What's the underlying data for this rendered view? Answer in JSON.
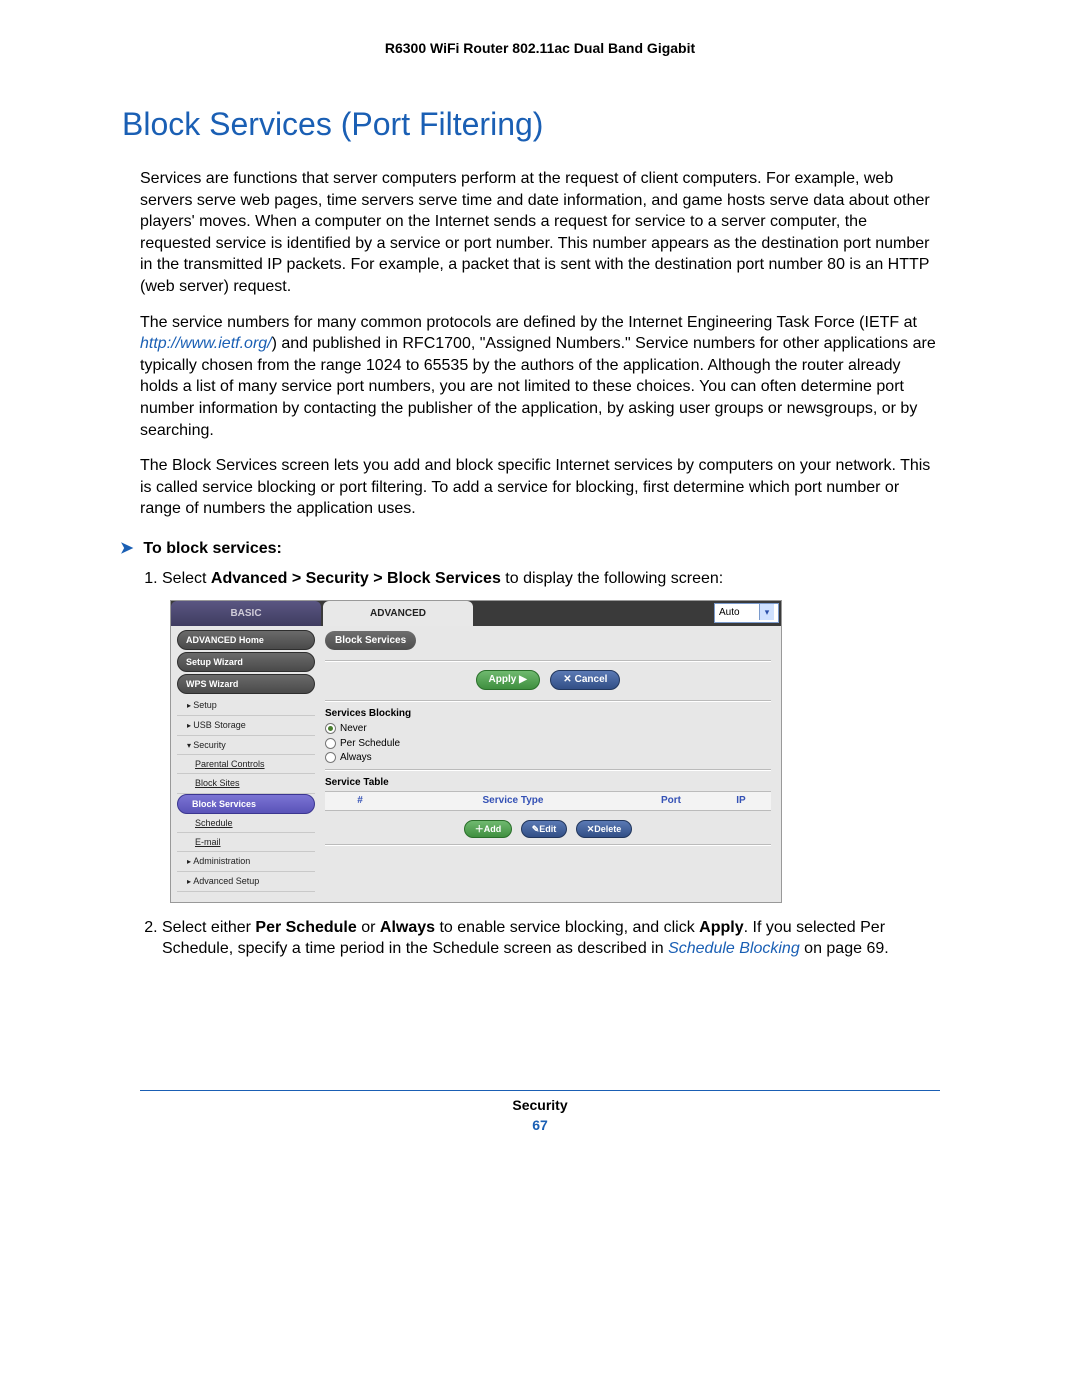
{
  "header": {
    "product": "R6300 WiFi Router 802.11ac Dual Band Gigabit"
  },
  "title": "Block Services (Port Filtering)",
  "paras": {
    "p1": "Services are functions that server computers perform at the request of client computers. For example, web servers serve web pages, time servers serve time and date information, and game hosts serve data about other players' moves. When a computer on the Internet sends a request for service to a server computer, the requested service is identified by a service or port number. This number appears as the destination port number in the transmitted IP packets. For example, a packet that is sent with the destination port number 80 is an HTTP (web server) request.",
    "p2a": "The service numbers for many common protocols are defined by the Internet Engineering Task Force (IETF at ",
    "p2_link": "http://www.ietf.org/",
    "p2b": ") and published in RFC1700, \"Assigned Numbers.\" Service numbers for other applications are typically chosen from the range 1024 to 65535 by the authors of the application. Although the router already holds a list of many service port numbers, you are not limited to these choices. You can often determine port number information by contacting the publisher of the application, by asking user groups or newsgroups, or by searching.",
    "p3": "The Block Services screen lets you add and block specific Internet services by computers on your network. This is called service blocking or port filtering. To add a service for blocking, first determine which port number or range of numbers the application uses."
  },
  "procedure": {
    "heading": "To block services:",
    "step1_a": "Select ",
    "step1_bold": "Advanced > Security > Block Services",
    "step1_b": " to display the following screen:",
    "step2_a": "Select either ",
    "step2_b1": "Per Schedule",
    "step2_or": " or ",
    "step2_b2": "Always",
    "step2_c": " to enable service blocking, and click ",
    "step2_apply": "Apply",
    "step2_d": ". If you selected Per Schedule, specify a time period in the Schedule screen as described in ",
    "step2_link": "Schedule Blocking",
    "step2_e": " on page 69."
  },
  "screenshot": {
    "tabs": {
      "basic": "BASIC",
      "advanced": "ADVANCED"
    },
    "auto": "Auto",
    "sidebar": {
      "home": "ADVANCED Home",
      "setup_wizard": "Setup Wizard",
      "wps_wizard": "WPS Wizard",
      "setup": "Setup",
      "usb": "USB Storage",
      "security": "Security",
      "sec_items": {
        "parental": "Parental Controls",
        "block_sites": "Block Sites",
        "block_services": "Block Services",
        "schedule": "Schedule",
        "email": "E-mail"
      },
      "admin": "Administration",
      "advsetup": "Advanced Setup"
    },
    "panel": {
      "title": "Block Services",
      "apply": "Apply",
      "cancel": "Cancel",
      "svc_blocking": "Services Blocking",
      "radios": {
        "never": "Never",
        "per_schedule": "Per Schedule",
        "always": "Always"
      },
      "svc_table": "Service Table",
      "cols": {
        "num": "#",
        "type": "Service Type",
        "port": "Port",
        "ip": "IP"
      },
      "add": "Add",
      "edit": "Edit",
      "delete": "Delete"
    }
  },
  "footer": {
    "section": "Security",
    "page": "67"
  }
}
